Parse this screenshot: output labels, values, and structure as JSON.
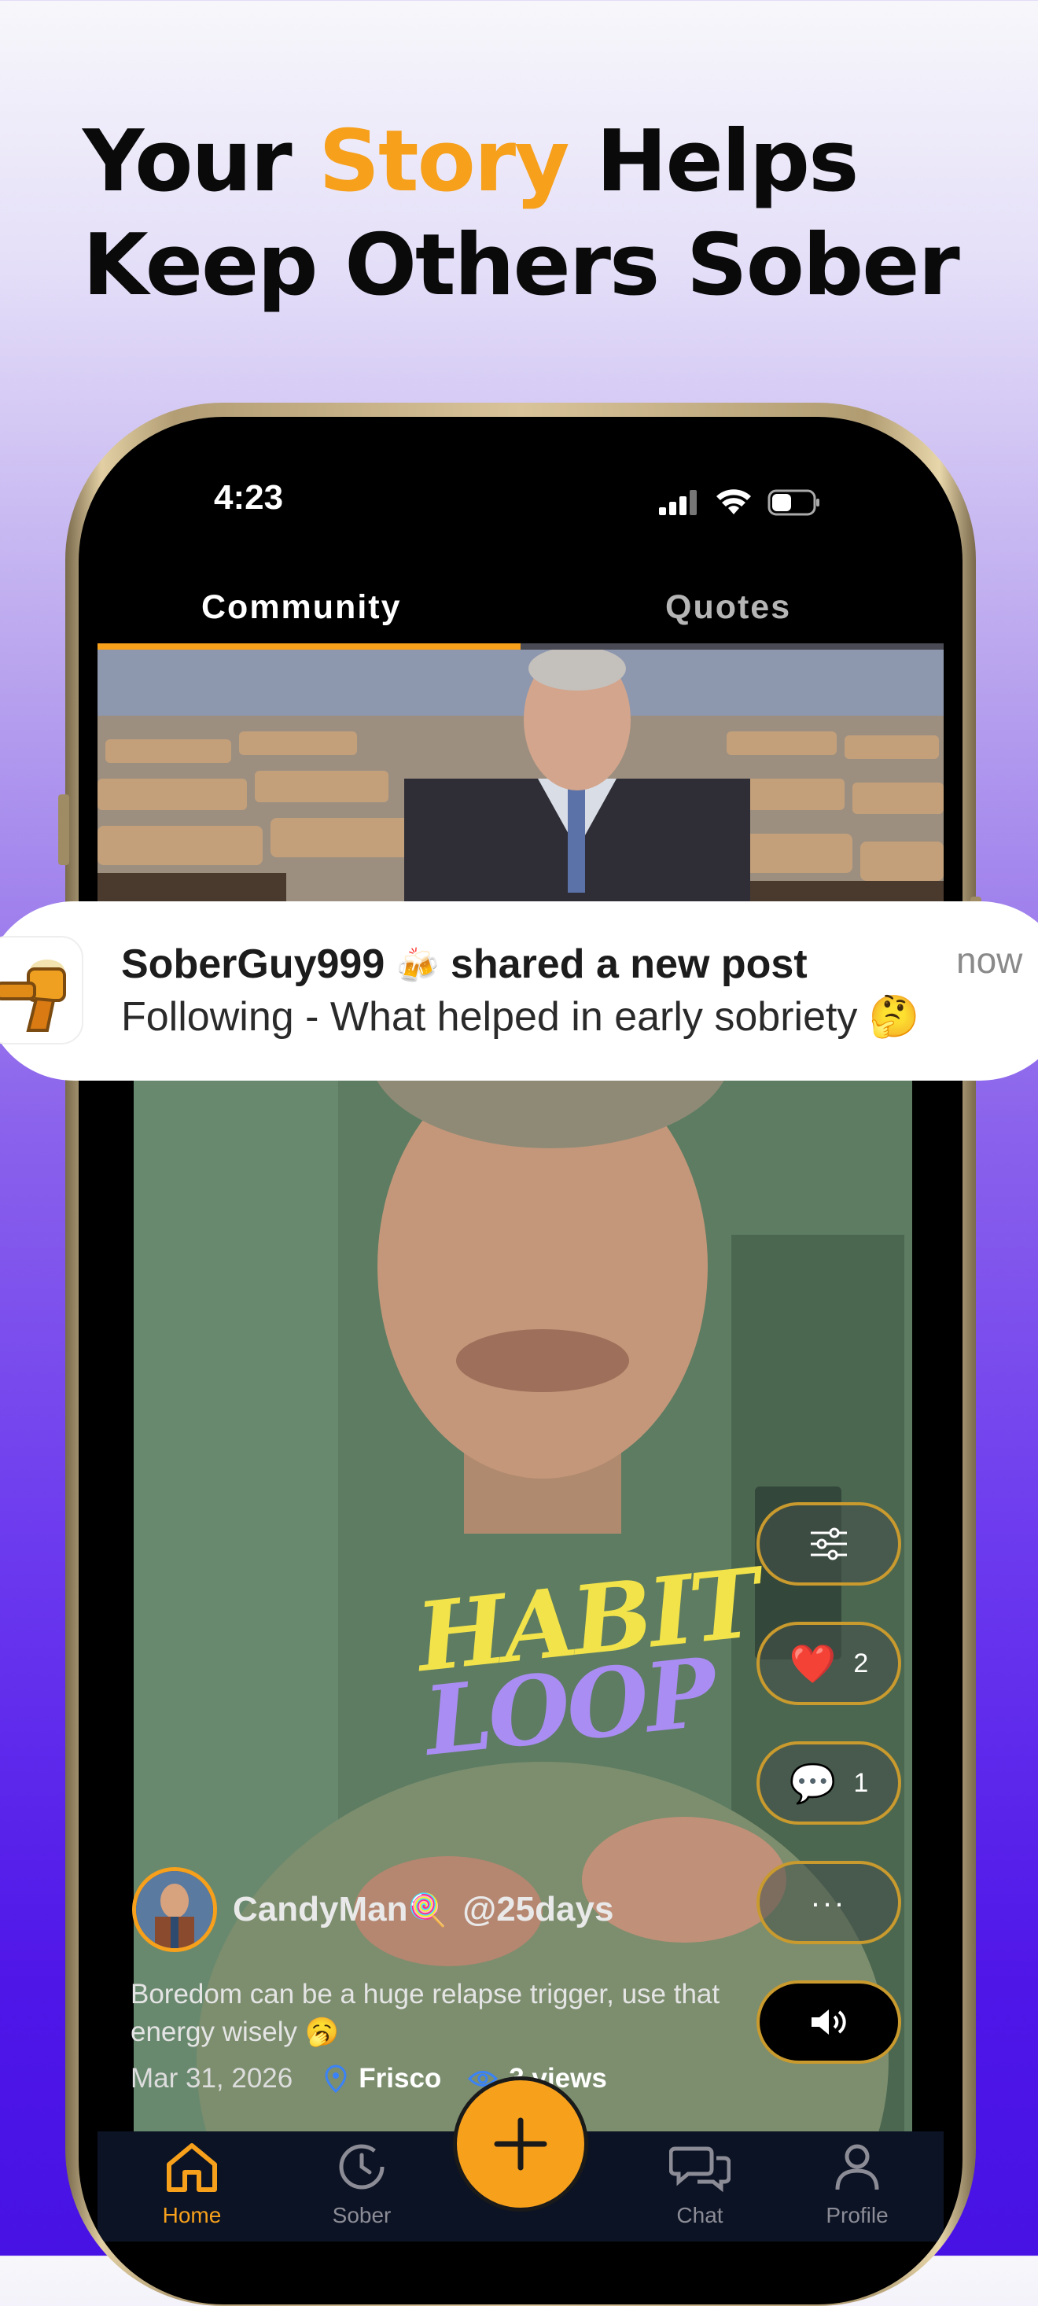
{
  "headline": {
    "line1_before": "Your",
    "line1_accent": "Story",
    "line1_after": "Helps",
    "line2": "Keep Others Sober"
  },
  "status_bar": {
    "time": "4:23"
  },
  "tabs": [
    {
      "label": "Community",
      "active": true
    },
    {
      "label": "Quotes",
      "active": false
    }
  ],
  "top_video_progress": 0.5,
  "notification": {
    "user": "SoberGuy999",
    "user_emoji": "🍻",
    "action": "shared a new post",
    "body": "Following - What helped in early sobriety",
    "body_emoji": "🤔",
    "time": "now"
  },
  "post": {
    "overlay_text_1": "HABIT",
    "overlay_text_2": "LOOP",
    "author": "CandyMan",
    "author_emoji": "🍭",
    "days": "@25days",
    "caption": "Boredom can be a huge relapse trigger, use that energy wisely",
    "caption_emoji": "🥱",
    "date": "Mar 31, 2026",
    "location": "Frisco",
    "views": "3 views",
    "likes": "2",
    "comments": "1",
    "more_label": "...",
    "like_emoji": "❤️",
    "comment_emoji": "💬"
  },
  "nav": [
    {
      "label": "Home",
      "icon": "home-icon",
      "active": true
    },
    {
      "label": "Sober",
      "icon": "clock-icon",
      "active": false
    },
    {
      "label": "Chat",
      "icon": "chat-bubbles-icon",
      "active": false
    },
    {
      "label": "Profile",
      "icon": "person-icon",
      "active": false
    }
  ],
  "colors": {
    "accent": "#f6a01c",
    "nav_bg": "#0c1324",
    "screen_bg": "#000000"
  }
}
